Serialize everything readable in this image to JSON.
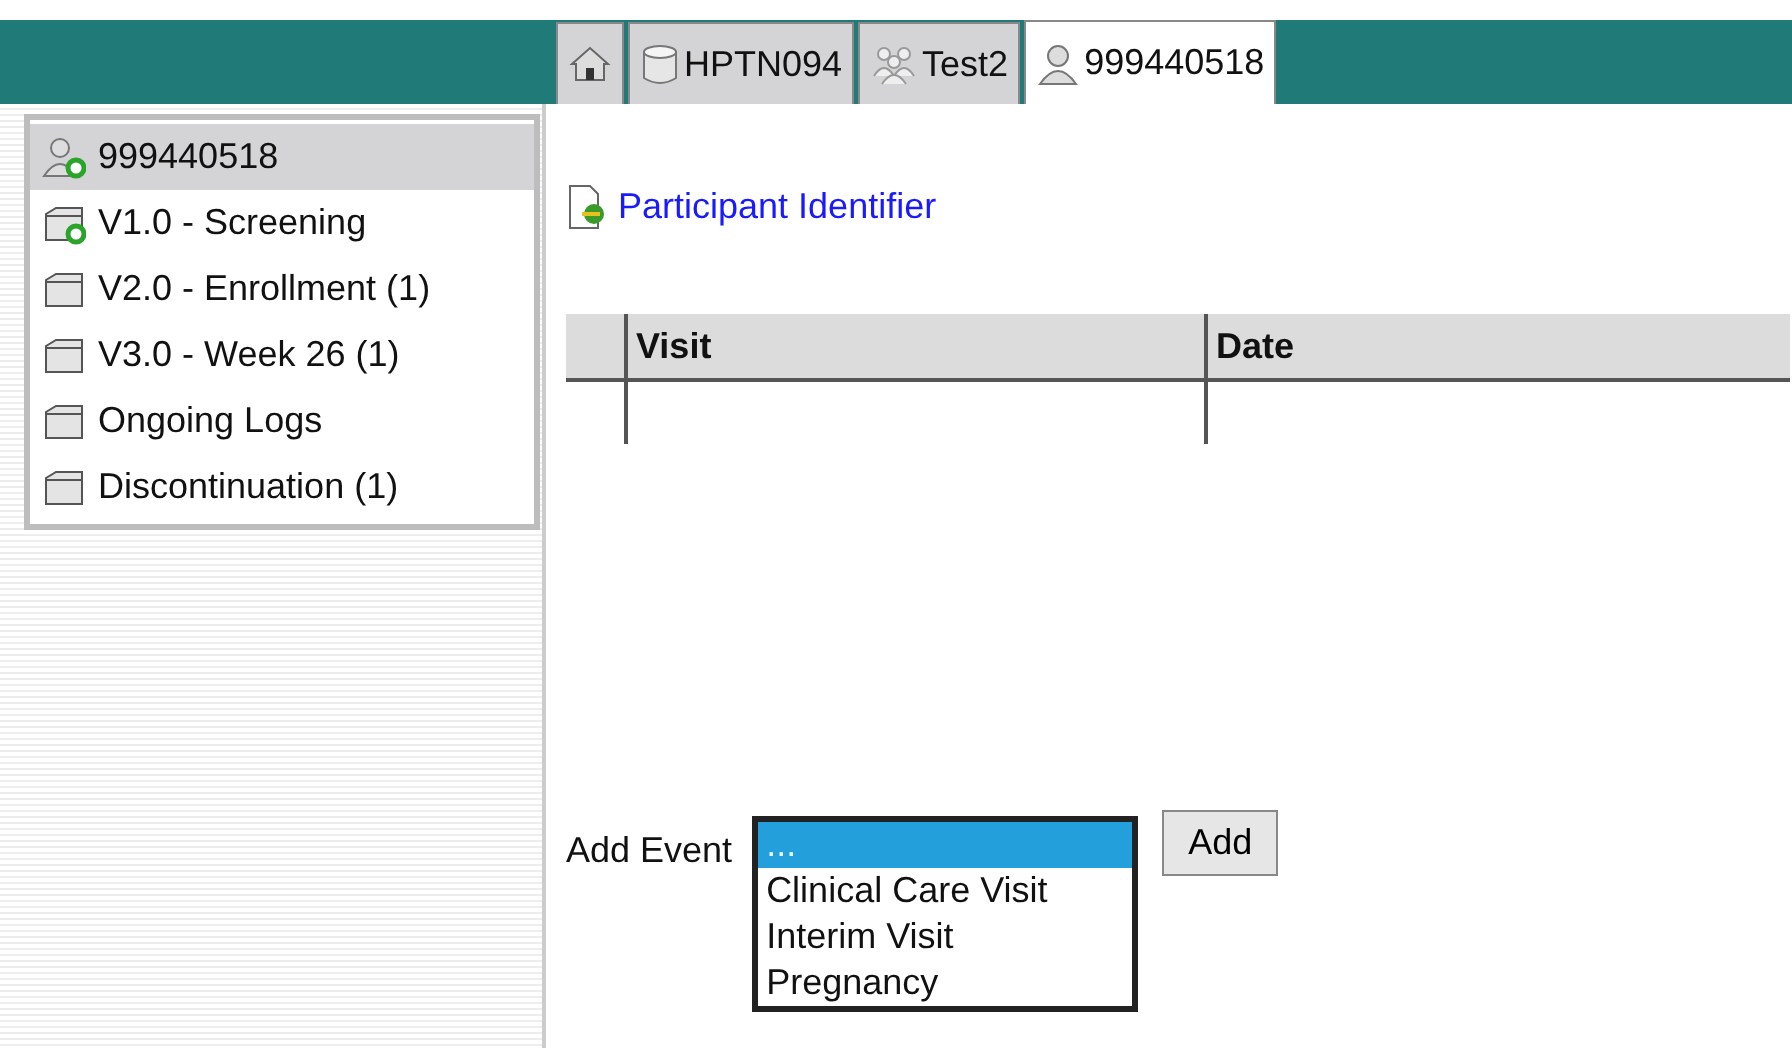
{
  "tabs": [
    {
      "kind": "home",
      "selected": false
    },
    {
      "kind": "study",
      "label": "HPTN094",
      "selected": false
    },
    {
      "kind": "group",
      "label": "Test2",
      "selected": false
    },
    {
      "kind": "participant",
      "label": "999440518",
      "selected": true
    }
  ],
  "tree": [
    {
      "kind": "participant",
      "label": "999440518",
      "status_dot": true,
      "selected": true
    },
    {
      "kind": "folder",
      "label": "V1.0 - Screening",
      "status_dot": true,
      "selected": false
    },
    {
      "kind": "folder",
      "label": "V2.0 - Enrollment (1)",
      "status_dot": false,
      "selected": false
    },
    {
      "kind": "folder",
      "label": "V3.0 - Week 26 (1)",
      "status_dot": false,
      "selected": false
    },
    {
      "kind": "folder",
      "label": "Ongoing Logs",
      "status_dot": false,
      "selected": false
    },
    {
      "kind": "folder",
      "label": "Discontinuation (1)",
      "status_dot": false,
      "selected": false
    }
  ],
  "identifier_link": "Participant Identifier",
  "table": {
    "columns": [
      "Visit",
      "Date"
    ]
  },
  "add_event": {
    "label": "Add Event",
    "options": [
      {
        "label": "...",
        "selected": true
      },
      {
        "label": "Clinical Care Visit",
        "selected": false
      },
      {
        "label": "Interim Visit",
        "selected": false
      },
      {
        "label": "Pregnancy",
        "selected": false
      }
    ],
    "button": "Add"
  }
}
